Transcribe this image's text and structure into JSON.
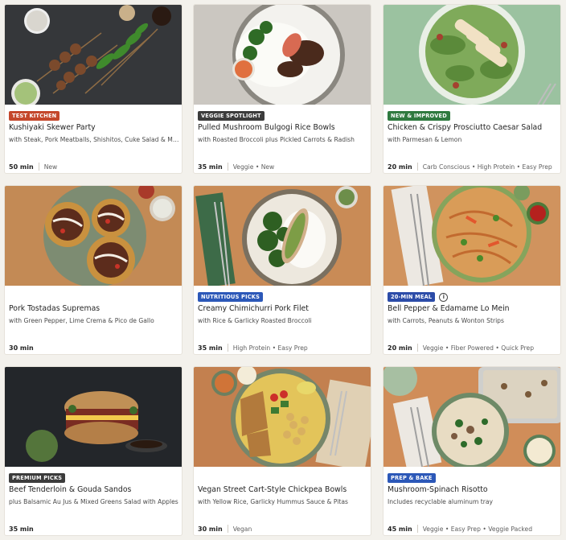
{
  "colors": {
    "page_bg": "#f3f1ec",
    "badge_test_kitchen": "#c4472b",
    "badge_dark": "#3c3c3c",
    "badge_new_improved": "#2f7a3f",
    "badge_nutritious": "#2c58b8",
    "badge_20min": "#2c4ca8",
    "badge_prep_bake": "#2c58b8"
  },
  "recipes": [
    {
      "badge": "TEST KITCHEN",
      "badge_color": "#c4472b",
      "title": "Kushiyaki Skewer Party",
      "subtitle": "with Steak, Pork Meatballs, Shishitos, Cuke Salad & Mayo Sauces",
      "time": "50 min",
      "tags": "New"
    },
    {
      "badge": "VEGGIE SPOTLIGHT",
      "badge_color": "#3c3c3c",
      "title": "Pulled Mushroom Bulgogi Rice Bowls",
      "subtitle": "with Roasted Broccoli plus Pickled Carrots & Radish",
      "time": "35 min",
      "tags": "Veggie • New"
    },
    {
      "badge": "NEW & IMPROVED",
      "badge_color": "#2f7a3f",
      "title": "Chicken & Crispy Prosciutto Caesar Salad",
      "subtitle": "with Parmesan & Lemon",
      "time": "20 min",
      "tags": "Carb Conscious • High Protein • Easy Prep"
    },
    {
      "badge": "",
      "badge_color": "",
      "title": "Pork Tostadas Supremas",
      "subtitle": "with Green Pepper, Lime Crema & Pico de Gallo",
      "time": "30 min",
      "tags": ""
    },
    {
      "badge": "NUTRITIOUS PICKS",
      "badge_color": "#2c58b8",
      "title": "Creamy Chimichurri Pork Filet",
      "subtitle": "with Rice & Garlicky Roasted Broccoli",
      "time": "35 min",
      "tags": "High Protein • Easy Prep"
    },
    {
      "badge": "20-MIN MEAL",
      "badge_color": "#2c4ca8",
      "info": "i",
      "title": "Bell Pepper & Edamame Lo Mein",
      "subtitle": "with Carrots, Peanuts & Wonton Strips",
      "time": "20 min",
      "tags": "Veggie • Fiber Powered • Quick Prep"
    },
    {
      "badge": "PREMIUM PICKS",
      "badge_color": "#3c3c3c",
      "title": "Beef Tenderloin & Gouda Sandos",
      "subtitle": "plus Balsamic Au Jus & Mixed Greens Salad with Apples",
      "time": "35 min",
      "tags": ""
    },
    {
      "badge": "",
      "badge_color": "",
      "title": "Vegan Street Cart-Style Chickpea Bowls",
      "subtitle": "with Yellow Rice, Garlicky Hummus Sauce & Pitas",
      "time": "30 min",
      "tags": "Vegan"
    },
    {
      "badge": "PREP & BAKE",
      "badge_color": "#2c58b8",
      "title": "Mushroom-Spinach Risotto",
      "subtitle": "Includes recyclable aluminum tray",
      "time": "45 min",
      "tags": "Veggie • Easy Prep • Veggie Packed"
    }
  ]
}
